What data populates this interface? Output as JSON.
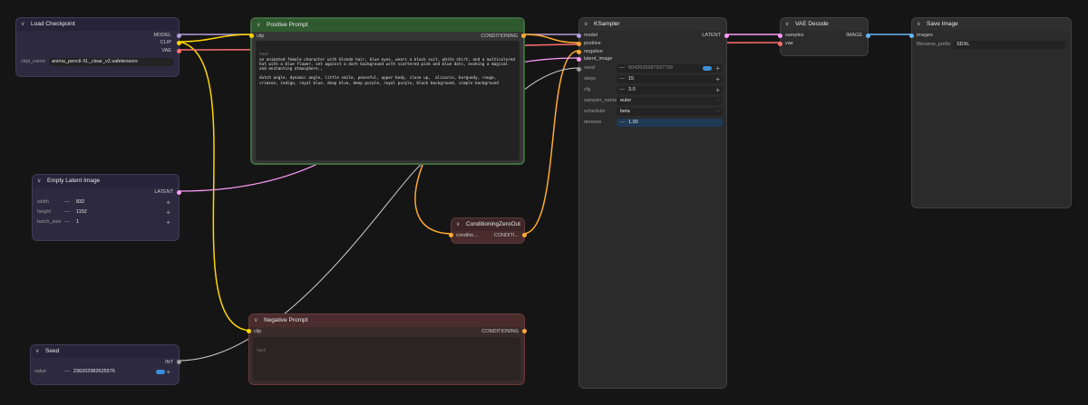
{
  "colors": {
    "canvas": "#151515",
    "model": "#b39ddb",
    "clip": "#ffd500",
    "vae": "#ff6e6e",
    "latent": "#ff9cf9",
    "conditioning": "#ffa931",
    "image": "#64b5f6",
    "int": "#9e9e9e",
    "prompt_pos": "#2f5a2f",
    "prompt_neg": "#5a2f2f",
    "purple_node": "#2f2a45"
  },
  "load_checkpoint": {
    "title": "Load Checkpoint",
    "out_model": "MODEL",
    "out_clip": "CLIP",
    "out_vae": "VAE",
    "ckpt_label": "ckpt_name",
    "ckpt_value": "anima_pencil-XL_clear_v2.safetensors"
  },
  "positive_prompt": {
    "title": "Positive Prompt",
    "in_clip": "clip",
    "out_cond": "CONDITIONING",
    "text_tag": "text",
    "text": "an animated female character with blonde hair, blue eyes, wears a black suit, white shirt, and a multicolored hat with a blue flower, set against a dark background with scattered pink and blue dots, evoking a magical and enchanting atmosphere.,\n\ndutch angle, dynamic angle, little smile, peaceful, upper body, close up,  alizarin, burgundy, rouge, crimson, indigo, royal blue, deep blue, deep purple, royal purple, black background, simple background"
  },
  "empty_latent": {
    "title": "Empty Latent Image",
    "out_latent": "LATENT",
    "width_label": "width",
    "width_value": "832",
    "height_label": "height",
    "height_value": "1152",
    "batch_label": "batch_size",
    "batch_value": "1"
  },
  "cond_zero": {
    "title": "ConditioningZeroOut",
    "in_cond": "conditio...",
    "out_cond": "CONDITI..."
  },
  "negative_prompt": {
    "title": "Negative Prompt",
    "in_clip": "clip",
    "out_cond": "CONDITIONING",
    "text_tag": "text"
  },
  "seed": {
    "title": "Seed",
    "out_int": "INT",
    "value_label": "value",
    "value": "236202982625576"
  },
  "ksampler": {
    "title": "KSampler",
    "in_model": "model",
    "in_positive": "positive",
    "in_negative": "negative",
    "in_latent": "latent_image",
    "out_latent": "LATENT",
    "seed_label": "seed",
    "seed_value": "6043525987937709",
    "steps_label": "steps",
    "steps_value": "15",
    "cfg_label": "cfg",
    "cfg_value": "3.0",
    "sampler_label": "sampler_name",
    "sampler_value": "euler",
    "scheduler_label": "scheduler",
    "scheduler_value": "beta",
    "denoise_label": "denoise",
    "denoise_value": "1.00"
  },
  "vae_decode": {
    "title": "VAE Decode",
    "in_samples": "samples",
    "in_vae": "vae",
    "out_image": "IMAGE"
  },
  "save_image": {
    "title": "Save Image",
    "in_images": "images",
    "prefix_label": "filename_prefix",
    "prefix_value": "SDXL"
  }
}
